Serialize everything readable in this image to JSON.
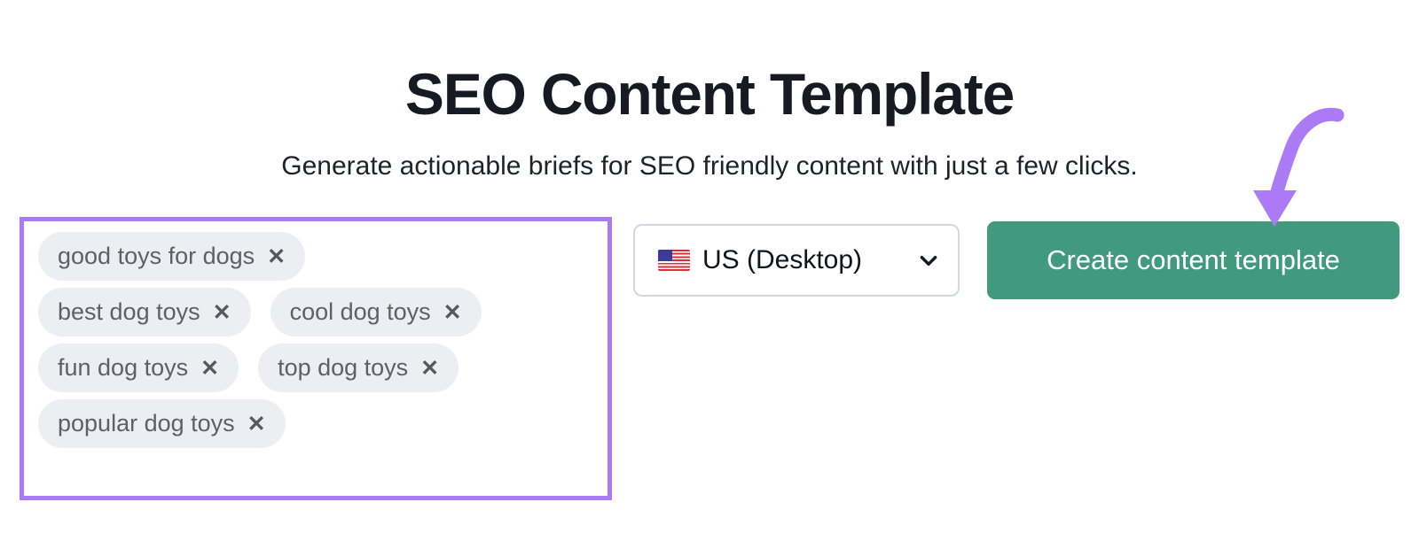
{
  "header": {
    "title": "SEO Content Template",
    "subtitle": "Generate actionable briefs for SEO friendly content with just a few clicks."
  },
  "keyword_input": {
    "chip_close_glyph": "✕",
    "rows": [
      [
        {
          "label": "good toys for dogs"
        }
      ],
      [
        {
          "label": "best dog toys"
        },
        {
          "label": "cool dog toys"
        }
      ],
      [
        {
          "label": "fun dog toys"
        },
        {
          "label": "top dog toys"
        }
      ],
      [
        {
          "label": "popular dog toys"
        }
      ]
    ]
  },
  "locale_select": {
    "flag_icon": "us-flag-icon",
    "selected": "US (Desktop)",
    "chevron_icon": "chevron-down-icon"
  },
  "primary_action": {
    "label": "Create content template"
  },
  "annotation": {
    "icon": "curved-arrow-icon"
  },
  "colors": {
    "highlight_purple": "#ab7bf5",
    "button_green": "#419a7e",
    "chip_background": "#edeef2",
    "chip_text": "#5c6069",
    "title_text": "#171a22"
  }
}
